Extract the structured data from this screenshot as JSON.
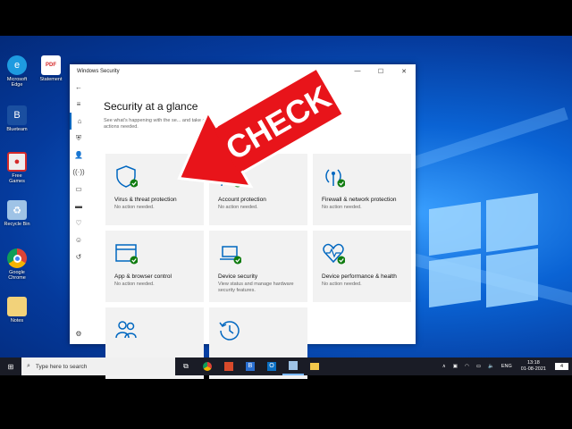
{
  "window": {
    "title": "Windows Security",
    "page_title": "Security at a glance",
    "subtitle": "See what's happening with the security of your device and take any actions needed.",
    "subtitle_visible": "See what's happening with the se... and take any actions needed."
  },
  "tiles": [
    {
      "name": "Virus & threat protection",
      "status": "No action needed.",
      "icon": "shield-icon"
    },
    {
      "name": "Account protection",
      "status": "No action needed.",
      "icon": "person-icon"
    },
    {
      "name": "Firewall & network protection",
      "status": "No action needed.",
      "icon": "antenna-icon"
    },
    {
      "name": "App & browser control",
      "status": "No action needed.",
      "icon": "browser-window-icon"
    },
    {
      "name": "Device security",
      "status": "View status and manage hardware security features.",
      "icon": "laptop-icon"
    },
    {
      "name": "Device performance & health",
      "status": "No action needed.",
      "icon": "heart-pulse-icon"
    },
    {
      "name": "",
      "status": "",
      "icon": "family-icon"
    },
    {
      "name": "",
      "status": "",
      "icon": "history-icon"
    }
  ],
  "overlay": {
    "text": "CHECK",
    "color": "#e8141a"
  },
  "desktop_icons": [
    {
      "label": "Microsoft Edge",
      "icon": "edge-icon",
      "color": "#1e9be0"
    },
    {
      "label": "Blueteam",
      "icon": "b-app-icon",
      "color": "#1a4fa0"
    },
    {
      "label": "Free Games",
      "icon": "screen-recorder-icon",
      "color": "#d42a2a"
    },
    {
      "label": "Recycle Bin",
      "icon": "recycle-bin-icon",
      "color": "#9fc3e6"
    },
    {
      "label": "Google Chrome",
      "icon": "chrome-icon",
      "color": "#ffffff"
    },
    {
      "label": "Notes",
      "icon": "folder-icon",
      "color": "#f2d27a"
    }
  ],
  "desktop_icon_right": {
    "label": "Statement",
    "icon": "pdf-icon"
  },
  "taskbar": {
    "search_placeholder": "Type here to search",
    "language": "ENG",
    "time": "13:18",
    "date": "01-08-2021",
    "notifications": "4"
  },
  "colors": {
    "accent": "#0067c0",
    "ok_badge": "#107c10",
    "taskbar": "#1a1c26"
  }
}
